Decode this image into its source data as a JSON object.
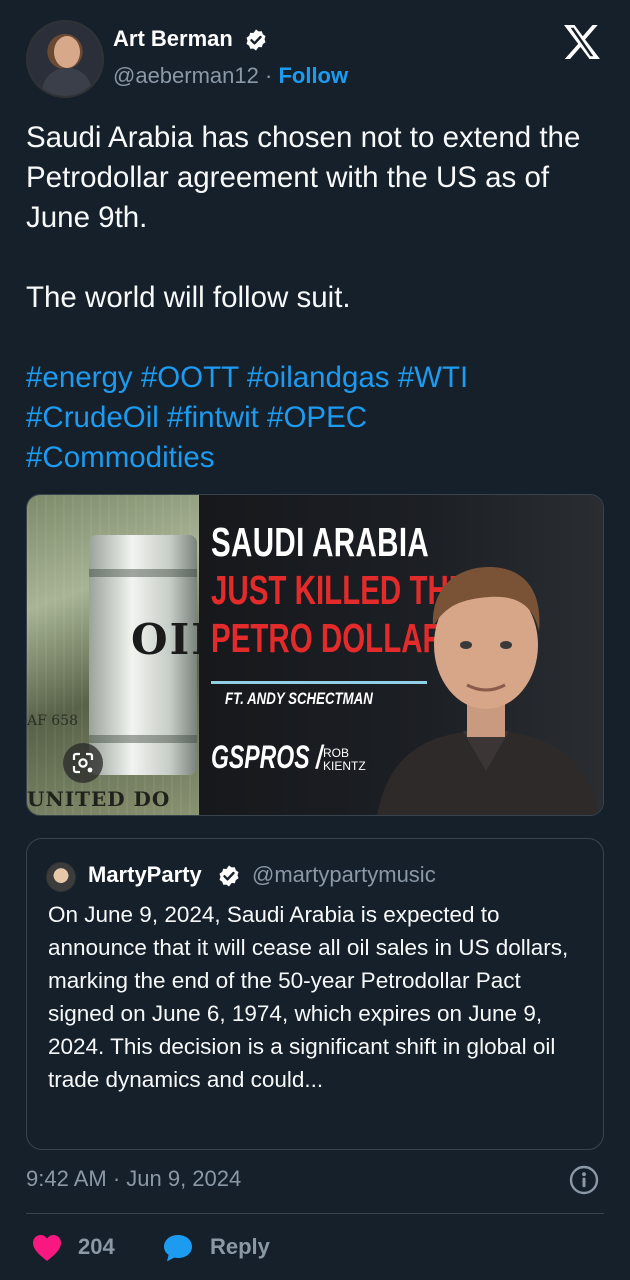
{
  "author": {
    "name": "Art Berman",
    "handle": "@aeberman12",
    "separator": "·",
    "follow_label": "Follow"
  },
  "tweet": {
    "paragraphs": [
      "Saudi Arabia has chosen not to extend the Petrodollar agreement with the US as of June 9th.",
      "The world will follow suit."
    ],
    "hashtags_line1": [
      "#energy",
      "#OOTT",
      "#oilandgas",
      "#WTI"
    ],
    "hashtags_line2": [
      "#CrudeOil",
      "#fintwit",
      "#OPEC"
    ],
    "hashtags_line3": [
      "#Commodities"
    ]
  },
  "media": {
    "title_line1": "SAUDI ARABIA",
    "title_line2": "JUST KILLED THE",
    "title_line3": "PETRO DOLLAR",
    "featuring": "FT. ANDY SCHECTMAN",
    "channel": "GSPROS /",
    "host": "ROB KIENTZ",
    "barrel_label": "OIL",
    "bill_text_top": "AF 658",
    "bill_text_bottom": "UNITED DO"
  },
  "quote": {
    "name": "MartyParty",
    "handle": "@martypartymusic",
    "text": "On June 9, 2024, Saudi Arabia is expected to announce that it will cease all oil sales in US dollars, marking the end of the 50-year Petrodollar Pact signed on June 6, 1974, which expires on June 9, 2024. This decision is a significant shift in global oil trade dynamics and could..."
  },
  "meta": {
    "timestamp": "9:42 AM · Jun 9, 2024"
  },
  "actions": {
    "like_count": "204",
    "reply_label": "Reply"
  },
  "colors": {
    "background": "#15202b",
    "accent": "#1d9bf0",
    "like": "#f91880",
    "muted": "#8b98a5",
    "headline_red": "#e32b2b"
  },
  "icons": [
    "verified-badge-icon",
    "x-logo-icon",
    "info-icon",
    "heart-icon",
    "reply-bubble-icon",
    "google-lens-icon"
  ]
}
